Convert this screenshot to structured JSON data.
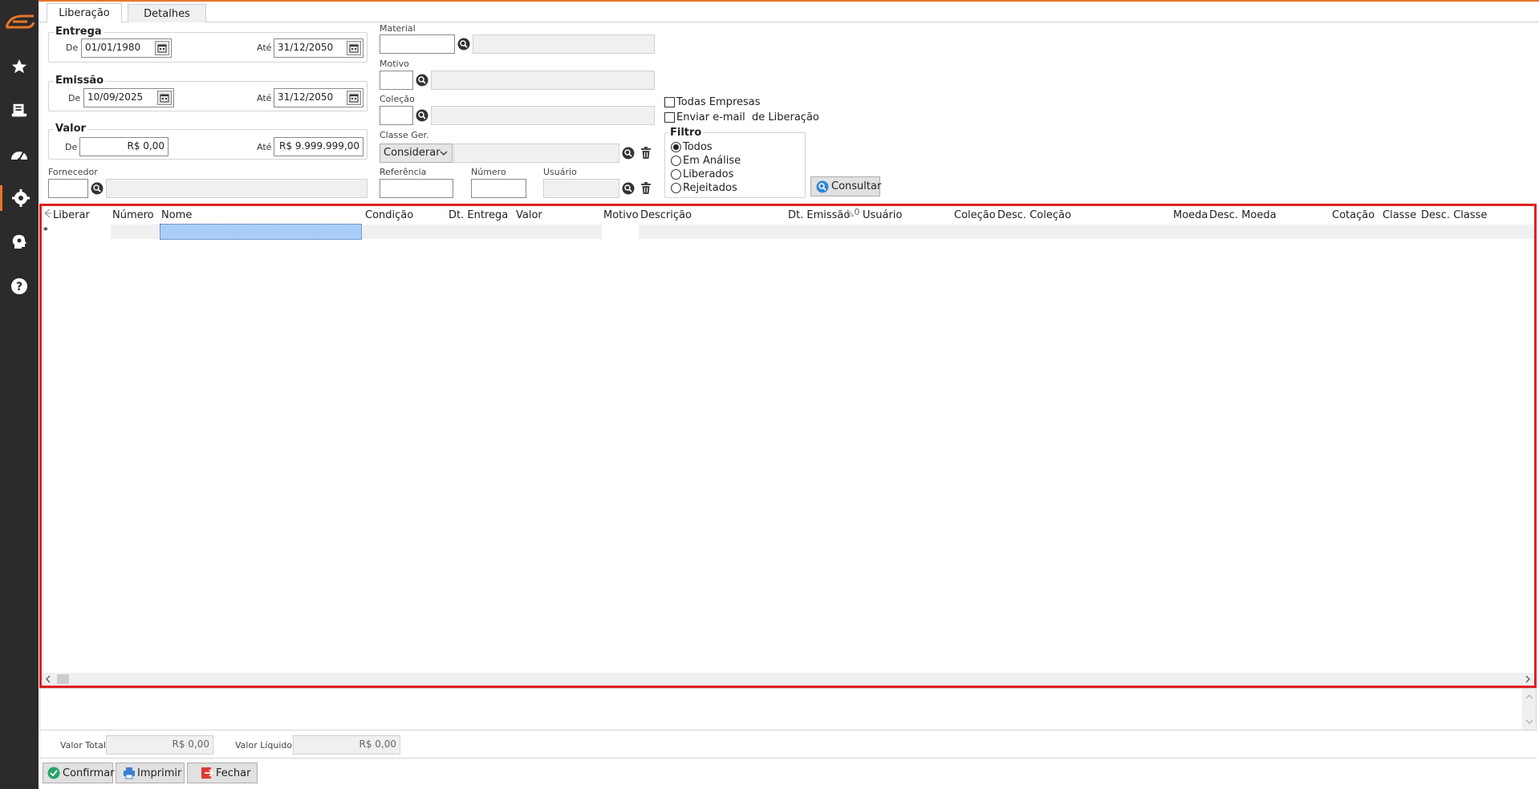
{
  "tabs": [
    {
      "label": "Liberação",
      "active": true
    },
    {
      "label": "Detalhes",
      "active": false
    }
  ],
  "entrega": {
    "title": "Entrega",
    "de_label": "De",
    "de_value": "01/01/1980",
    "ate_label": "Até",
    "ate_value": "31/12/2050"
  },
  "emissao": {
    "title": "Emissão",
    "de_label": "De",
    "de_value": "10/09/2025",
    "ate_label": "Até",
    "ate_value": "31/12/2050"
  },
  "valor": {
    "title": "Valor",
    "de_label": "De",
    "de_value": "R$ 0,00",
    "ate_label": "Até",
    "ate_value": "R$ 9.999.999,00"
  },
  "fornecedor": {
    "label": "Fornecedor",
    "code": "",
    "desc": ""
  },
  "material": {
    "label": "Material",
    "code": "",
    "desc": ""
  },
  "motivo": {
    "label": "Motivo",
    "code": "",
    "desc": ""
  },
  "colecao": {
    "label": "Coleção",
    "code": "",
    "desc": ""
  },
  "classe_ger": {
    "label": "Classe Ger.",
    "selected": "Considerar",
    "desc": ""
  },
  "referencia": {
    "label": "Referência",
    "value": ""
  },
  "numero": {
    "label": "Número",
    "value": ""
  },
  "usuario": {
    "label": "Usuário",
    "value": ""
  },
  "checkboxes": {
    "todas_empresas": {
      "label": "Todas Empresas",
      "checked": false
    },
    "enviar_email": {
      "label": "Enviar e-mail  de Liberação",
      "checked": false
    }
  },
  "filtro": {
    "title": "Filtro",
    "options": [
      "Todos",
      "Em Análise",
      "Liberados",
      "Rejeitados"
    ],
    "selected": "Todos"
  },
  "consultar_label": "Consultar",
  "grid": {
    "columns": [
      "Liberar",
      "Número",
      "Nome",
      "Condição",
      "Dt. Entrega",
      "Valor",
      "Motivo",
      "Descrição",
      "Dt. Emissão",
      "Usuário",
      "Coleção",
      "Desc. Coleção",
      "Moeda",
      "Desc. Moeda",
      "Cotação",
      "Classe",
      "Desc. Classe"
    ],
    "new_row_marker": "*",
    "sort_marker": "0"
  },
  "totais": {
    "valor_total_label": "Valor Total",
    "valor_total": "R$ 0,00",
    "valor_liquido_label": "Valor Líquido",
    "valor_liquido": "R$ 0,00"
  },
  "actions": {
    "confirmar": "Confirmar",
    "imprimir": "Imprimir",
    "fechar": "Fechar"
  },
  "colors": {
    "accent": "#e9742b",
    "sidebar": "#2b2b2b",
    "grid_border": "#e02020",
    "selection": "#a9cdf6"
  }
}
